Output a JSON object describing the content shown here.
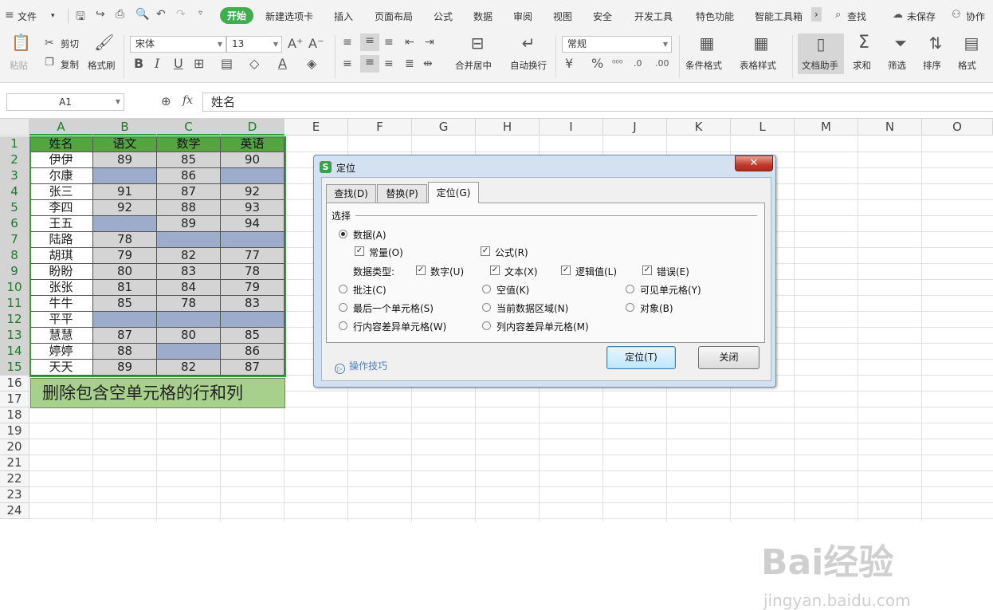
{
  "menubar": {
    "file_label": "文件",
    "tabs": [
      "开始",
      "新建选项卡",
      "插入",
      "页面布局",
      "公式",
      "数据",
      "审阅",
      "视图",
      "安全",
      "开发工具",
      "特色功能",
      "智能工具箱"
    ],
    "active_tab": "开始",
    "more": "›",
    "search_label": "查找",
    "unsaved_label": "未保存",
    "collab_label": "协作"
  },
  "ribbon": {
    "paste": "粘贴",
    "cut": "剪切",
    "copy": "复制",
    "format_painter": "格式刷",
    "font_name": "宋体",
    "font_size": "13",
    "merge_center": "合并居中",
    "wrap_text": "自动换行",
    "number_format": "常规",
    "conditional_format": "条件格式",
    "table_style": "表格样式",
    "doc_assistant": "文档助手",
    "sum": "求和",
    "filter": "筛选",
    "sort": "排序",
    "format": "格式"
  },
  "formula_bar": {
    "name_box": "A1",
    "fx": "fx",
    "value": "姓名"
  },
  "sheet": {
    "columns": [
      "A",
      "B",
      "C",
      "D",
      "E",
      "F",
      "G",
      "H",
      "I",
      "J",
      "K",
      "L",
      "M",
      "N",
      "O"
    ],
    "rows": [
      "1",
      "2",
      "3",
      "4",
      "5",
      "6",
      "7",
      "8",
      "9",
      "10",
      "11",
      "12",
      "13",
      "14",
      "15",
      "16",
      "17",
      "18",
      "19",
      "20",
      "21",
      "22",
      "23",
      "24"
    ],
    "header": [
      "姓名",
      "语文",
      "数学",
      "英语"
    ],
    "data": [
      [
        "伊伊",
        "89",
        "85",
        "90"
      ],
      [
        "尔康",
        "",
        "86",
        ""
      ],
      [
        "张三",
        "91",
        "87",
        "92"
      ],
      [
        "李四",
        "92",
        "88",
        "93"
      ],
      [
        "王五",
        "",
        "89",
        "94"
      ],
      [
        "陆路",
        "78",
        "",
        ""
      ],
      [
        "胡琪",
        "79",
        "82",
        "77"
      ],
      [
        "盼盼",
        "80",
        "83",
        "78"
      ],
      [
        "张张",
        "81",
        "84",
        "79"
      ],
      [
        "牛牛",
        "85",
        "78",
        "83"
      ],
      [
        "平平",
        "",
        "",
        ""
      ],
      [
        "慧慧",
        "87",
        "80",
        "85"
      ],
      [
        "婷婷",
        "88",
        "",
        "86"
      ],
      [
        "天天",
        "89",
        "82",
        "87"
      ]
    ],
    "note": "删除包含空单元格的行和列"
  },
  "dialog": {
    "title": "定位",
    "tabs": [
      "查找(D)",
      "替换(P)",
      "定位(G)"
    ],
    "active_tab": "定位(G)",
    "group_label": "选择",
    "data_option": "数据(A)",
    "constants": "常量(O)",
    "formulas": "公式(R)",
    "data_types_label": "数据类型:",
    "numbers": "数字(U)",
    "text": "文本(X)",
    "logicals": "逻辑值(L)",
    "errors": "错误(E)",
    "comments": "批注(C)",
    "blanks": "空值(K)",
    "visible_cells": "可见单元格(Y)",
    "last_cell": "最后一个单元格(S)",
    "current_region": "当前数据区域(N)",
    "objects": "对象(B)",
    "row_differences": "行内容差异单元格(W)",
    "column_differences": "列内容差异单元格(M)",
    "tips": "操作技巧",
    "goto_button": "定位(T)",
    "close_button": "关闭"
  },
  "watermark": {
    "logo": "Bai经验",
    "url": "jingyan.baidu.com"
  }
}
